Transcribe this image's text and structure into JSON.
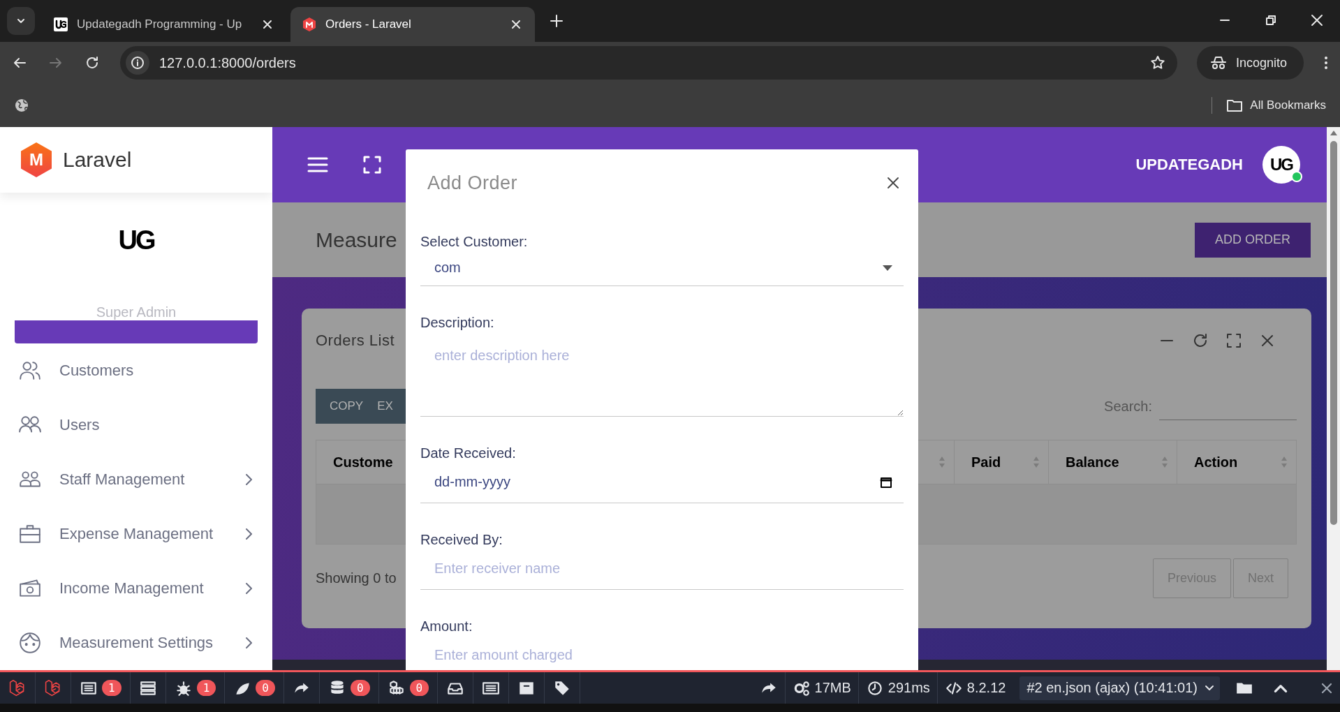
{
  "browser": {
    "tabs": [
      {
        "title": "Updategadh Programming - Up",
        "selected": false
      },
      {
        "title": "Orders - Laravel",
        "selected": true
      }
    ],
    "url": "127.0.0.1:8000/orders",
    "profile": "Incognito",
    "bookmarks_folder": "All Bookmarks"
  },
  "sidebar": {
    "brand": "Laravel",
    "brand_mark": "M",
    "logo_text": "UG",
    "role": "Super Admin",
    "items": [
      {
        "selected": true
      },
      {
        "label": "Customers",
        "selected": false,
        "submenu": false
      },
      {
        "label": "Users",
        "selected": false,
        "submenu": false
      },
      {
        "label": "Staff Management",
        "selected": false,
        "submenu": true
      },
      {
        "label": "Expense Management",
        "selected": false,
        "submenu": true
      },
      {
        "label": "Income Management",
        "selected": false,
        "submenu": true
      },
      {
        "label": "Measurement Settings",
        "selected": false,
        "submenu": true
      }
    ]
  },
  "header": {
    "user": "UPDATEGADH",
    "avatar_text": "UG",
    "online": true
  },
  "page": {
    "title": "Measure",
    "add_button": "ADD ORDER"
  },
  "card": {
    "title": "Orders List",
    "buttons": [
      "COPY",
      "EX"
    ],
    "search_label": "Search:",
    "columns": [
      "Custome",
      "Paid",
      "Balance",
      "Action"
    ],
    "info": "Showing 0 to",
    "pagination": [
      {
        "label": "Previous",
        "disabled": true
      },
      {
        "label": "Next",
        "disabled": true
      }
    ]
  },
  "modal": {
    "title": "Add Order",
    "fields": [
      {
        "kind": "select",
        "label": "Select Customer:",
        "value": "com"
      },
      {
        "kind": "textarea",
        "label": "Description:",
        "placeholder": "enter description here"
      },
      {
        "kind": "date",
        "label": "Date Received:",
        "value": "dd-mm-yyyy"
      },
      {
        "kind": "text",
        "label": "Received By:",
        "placeholder": "Enter receiver name"
      },
      {
        "kind": "text",
        "label": "Amount:",
        "placeholder": "Enter amount charged"
      }
    ]
  },
  "debugbar": {
    "tabs": [
      {
        "kind": "logo"
      },
      {
        "kind": "logo"
      },
      {
        "kind": "messages",
        "badge": "1"
      },
      {
        "kind": "timeline"
      },
      {
        "kind": "exceptions",
        "badge": "1"
      },
      {
        "kind": "views",
        "badge": "0"
      },
      {
        "kind": "route"
      },
      {
        "kind": "queries",
        "badge": "0"
      },
      {
        "kind": "models",
        "badge": "0"
      },
      {
        "kind": "mails"
      },
      {
        "kind": "gate"
      },
      {
        "kind": "session"
      },
      {
        "kind": "tags"
      }
    ],
    "stats": [
      {
        "kind": "memory",
        "text": "17MB"
      },
      {
        "kind": "time",
        "text": "291ms"
      },
      {
        "kind": "version",
        "text": "8.2.12"
      }
    ],
    "request": "#2 en.json (ajax) (10:41:01)"
  }
}
